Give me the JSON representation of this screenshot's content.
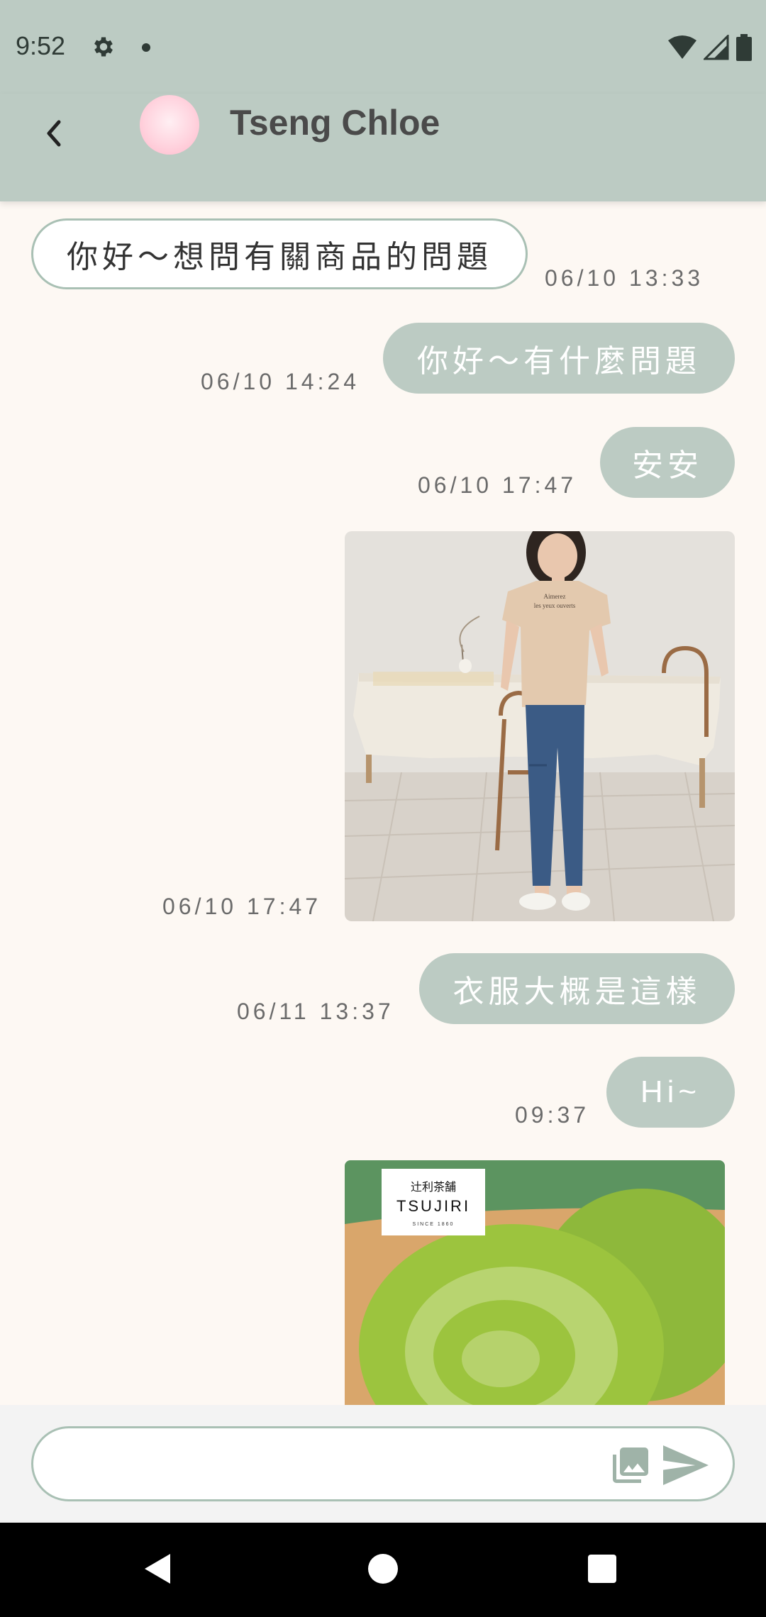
{
  "status_bar": {
    "time": "9:52",
    "icons": [
      "gear-icon",
      "dot-icon",
      "wifi-icon",
      "signal-icon",
      "battery-icon"
    ]
  },
  "header": {
    "back_icon": "chevron-left-icon",
    "contact_name": "Tseng Chloe"
  },
  "messages": [
    {
      "direction": "incoming",
      "type": "text",
      "text": "你好～想問有關商品的問題",
      "time": "06/10 13:33"
    },
    {
      "direction": "outgoing",
      "type": "text",
      "text": "你好～有什麼問題",
      "time": "06/10 14:24"
    },
    {
      "direction": "outgoing",
      "type": "text",
      "text": "安安",
      "time": "06/10 17:47"
    },
    {
      "direction": "outgoing",
      "type": "image",
      "image_desc": "woman-in-beige-tshirt-photo",
      "shirt_print": "Aimerez les yeux ouverts",
      "time": "06/10 17:47"
    },
    {
      "direction": "outgoing",
      "type": "text",
      "text": "衣服大概是這樣",
      "time": "06/11 13:37"
    },
    {
      "direction": "outgoing",
      "type": "text",
      "text": "Hi~",
      "time": "09:37"
    },
    {
      "direction": "outgoing",
      "type": "image",
      "image_desc": "matcha-roll-cake-photo",
      "logo_text_jp": "辻利茶舗",
      "logo_text": "TSUJIRI",
      "logo_since": "SINCE 1860",
      "time": ""
    }
  ],
  "input": {
    "value": "",
    "placeholder": "",
    "gallery_icon": "image-gallery-icon",
    "send_icon": "send-icon"
  },
  "colors": {
    "accent": "#BCCBC3",
    "bubble_border": "#A9C0B4",
    "chat_background": "#FDF8F3"
  },
  "nav_bar": {
    "icons": [
      "nav-back-icon",
      "nav-home-icon",
      "nav-recents-icon"
    ]
  }
}
